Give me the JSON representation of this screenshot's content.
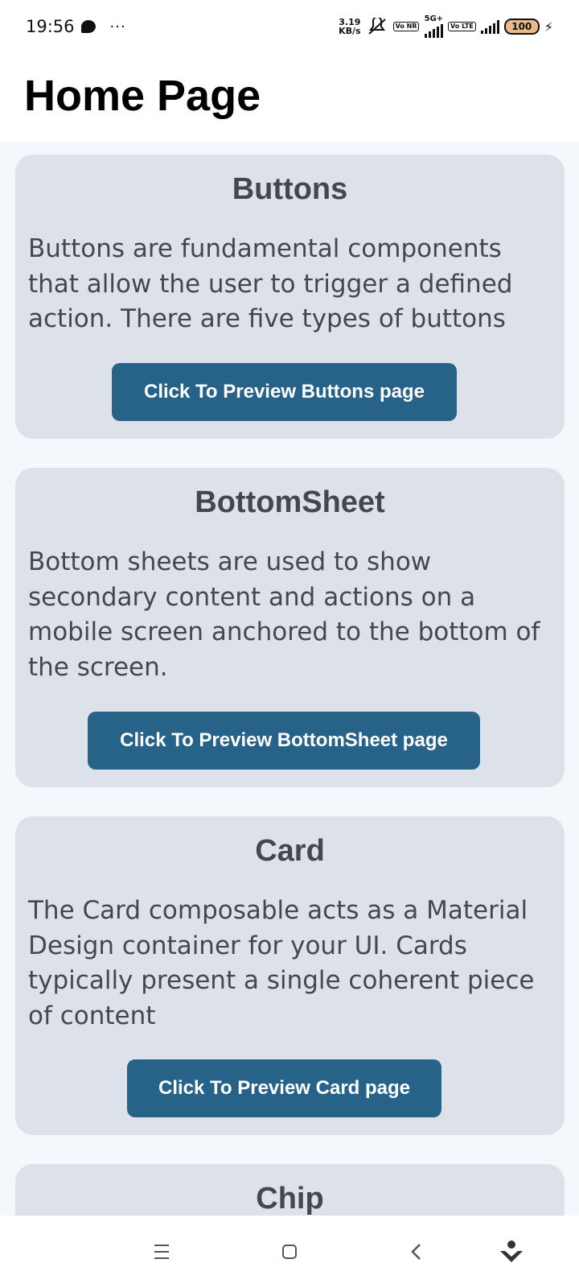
{
  "status_bar": {
    "time": "19:56",
    "overflow": "···",
    "net_speed_value": "3.19",
    "net_speed_unit": "KB/s",
    "vonr_badge": "Vo NR",
    "network_type": "5G+",
    "volte_badge": "Vo LTE",
    "battery_level": "100",
    "battery_color": "#e9b98c",
    "icons": [
      "chat-bubble-icon",
      "mute-icon",
      "signal-icon",
      "battery-icon",
      "charging-icon"
    ]
  },
  "header": {
    "title": "Home Page"
  },
  "cards": [
    {
      "title": "Buttons",
      "description": "Buttons are fundamental components that allow the user to trigger a defined action. There are five types of buttons",
      "button_label": "Click To Preview Buttons page"
    },
    {
      "title": "BottomSheet",
      "description": "Bottom sheets are used to show secondary content and actions on a mobile screen anchored to the bottom of the screen.",
      "button_label": "Click To Preview BottomSheet page"
    },
    {
      "title": "Card",
      "description": "The Card composable acts as a Material Design container for your UI. Cards typically present a single coherent piece of content",
      "button_label": "Click To Preview Card page"
    },
    {
      "title": "Chip"
    }
  ],
  "theme": {
    "card_background": "#dde1e9",
    "button_background": "#276389",
    "text_color": "#43474f",
    "page_background": "#f4f8fd"
  },
  "nav_bar": {
    "icons": [
      "menu-icon",
      "home-icon",
      "back-icon",
      "assistant-icon"
    ]
  }
}
